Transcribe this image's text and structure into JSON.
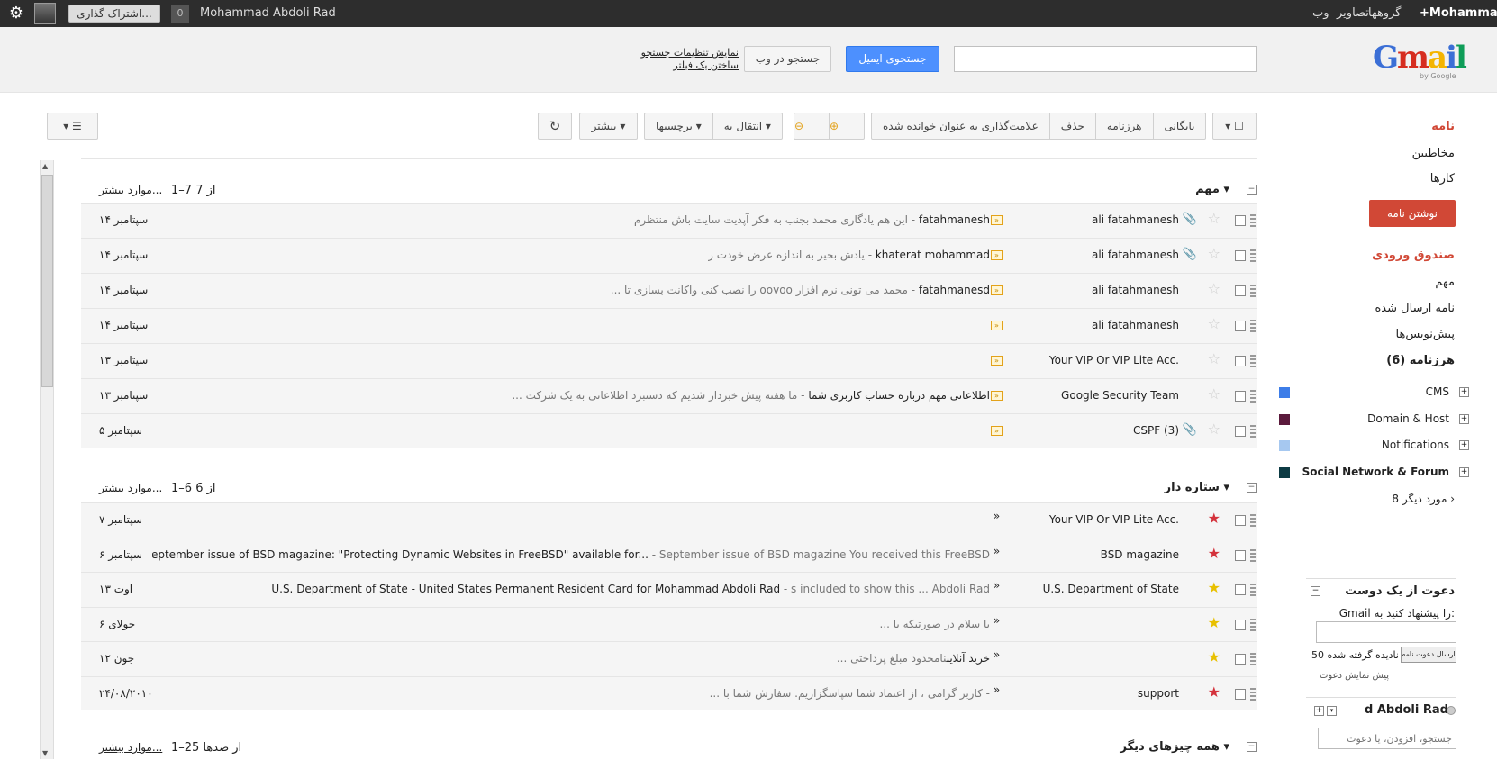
{
  "topbar": {
    "user_name": "Mohammad Abdoli Rad",
    "notif_count": "0",
    "share_label": "اشتراک گذاری...",
    "links": [
      "+Mohammad",
      "گروهها",
      "تصاویر",
      "وب"
    ]
  },
  "header": {
    "logo_text": "Gmail",
    "logo_by": "by Google",
    "search_mail_button": "جستجوی ایمیل",
    "search_web_button": "جستجو در وب",
    "show_search_options": "نمایش تنظیمات جستجو",
    "create_filter": "ساختن یک فیلتر"
  },
  "toolbar": {
    "archive": "بایگانی",
    "spam": "هرزنامه",
    "delete": "حذف",
    "mark_read": "علامت‌گذاری به عنوان خوانده شده",
    "move_to": "انتقال به ▾",
    "labels": "برچسبها ▾",
    "more": "بیشتر ▾"
  },
  "sections": [
    {
      "title": "مهم",
      "count": "1–7 از 7",
      "more": "موارد بیشتر...",
      "rows": [
        {
          "sender": "ali fatahmanesh",
          "subject": "fatahmanesh",
          "snippet": " - این هم یادگاری محمد بجنب به فکر آپدیت سایت باش منتظرم",
          "date": "۱۴ سپتامبر",
          "attach": true,
          "star": "none"
        },
        {
          "sender": "ali fatahmanesh",
          "subject": "khaterat mohammad",
          "snippet": " - یادش بخیر به اندازه عرض خودت ر",
          "date": "۱۴ سپتامبر",
          "attach": true,
          "star": "none"
        },
        {
          "sender": "ali fatahmanesh",
          "subject": "fatahmanesd",
          "snippet": " - محمد می تونی نرم افزار oovoo را نصب کنی واکانت بسازی تا ...",
          "date": "۱۴ سپتامبر",
          "attach": false,
          "star": "none"
        },
        {
          "sender": "ali fatahmanesh",
          "subject": "",
          "snippet": "",
          "date": "۱۴ سپتامبر",
          "attach": false,
          "star": "none"
        },
        {
          "sender": "Your VIP Or VIP Lite Acc.",
          "subject": "",
          "snippet": "",
          "date": "۱۳ سپتامبر",
          "attach": false,
          "star": "none"
        },
        {
          "sender": "Google Security Team",
          "subject": "اطلاعاتی مهم درباره حساب کاربری شما",
          "snippet": " - ما هفته پیش خبردار شدیم که دستبرد اطلاعاتی به یک شرکت ...",
          "date": "۱۳ سپتامبر",
          "attach": false,
          "star": "none"
        },
        {
          "sender": "CSPF (3)",
          "subject": "",
          "snippet": "",
          "date": "۵ سپتامبر",
          "attach": true,
          "star": "none"
        }
      ]
    },
    {
      "title": "ستاره دار",
      "count": "1–6 از 6",
      "more": "موارد بیشتر...",
      "rows": [
        {
          "sender": "Your VIP Or VIP Lite Acc.",
          "subject": "",
          "snippet": "",
          "date": "۷ سپتامبر",
          "attach": false,
          "star": "red"
        },
        {
          "sender": "BSD magazine",
          "subject": "September issue of BSD magazine: \"Protecting Dynamic Websites in FreeBSD\" available for...",
          "snippet": " - September issue of BSD magazine You received this FreeBSD",
          "date": "۶ سپتامبر",
          "attach": false,
          "star": "red"
        },
        {
          "sender": "U.S. Department of State",
          "subject": "U.S. Department of State - United States Permanent Resident Card for Mohammad Abdoli Rad",
          "snippet": " - s included to show this ... Abdoli Rad",
          "date": "۱۳ اوت",
          "attach": false,
          "star": "yellow"
        },
        {
          "sender": "",
          "subject": "",
          "snippet": "با سلام در صورتیکه با ...",
          "date": "۶ جولای",
          "attach": false,
          "star": "yellow"
        },
        {
          "sender": "",
          "subject": "خرید آنلاین",
          "snippet": "نامحدود مبلغ پرداختی ...",
          "date": "۱۲ جون",
          "attach": false,
          "star": "yellow"
        },
        {
          "sender": "support",
          "subject": "",
          "snippet": " - کاربر گرامی ، از اعتماد شما سپاسگزاریم. سفارش شما با ...",
          "date": "۲۴/۰۸/۲۰۱۰",
          "attach": false,
          "star": "red"
        }
      ]
    },
    {
      "title": "همه چیزهای دیگر",
      "count": "1–25 از صدها",
      "more": "موارد بیشتر..."
    }
  ],
  "sidebar": {
    "mail": "نامه",
    "contacts": "مخاطبین",
    "tasks": "کارها",
    "compose": "نوشتن نامه",
    "inbox": "صندوق ورودی",
    "important": "مهم",
    "sent": "نامه ارسال شده",
    "drafts": "پیش‌نویس‌ها",
    "spam": "هرزنامه (6)",
    "labels": [
      {
        "name": "CMS",
        "color": "#3d7de8"
      },
      {
        "name": "Domain & Host",
        "color": "#5b1a3c"
      },
      {
        "name": "Notifications",
        "color": "#a6c8f0"
      },
      {
        "name": "Social Network & Forum",
        "color": "#0d3b44"
      }
    ],
    "more_labels": "8 مورد دیگر ›",
    "invite_title": "دعوت از یک دوست",
    "invite_prompt": "Gmail را پیشنهاد کنید به:",
    "invite_send": "ارسال دعوت نامه",
    "invite_left": "50 نادیده گرفته شده",
    "invite_preview": "پیش نمایش دعوت",
    "chat_name": "d Abdoli Rad",
    "chat_search_placeholder": "جستجو، افزودن، یا دعوت"
  }
}
